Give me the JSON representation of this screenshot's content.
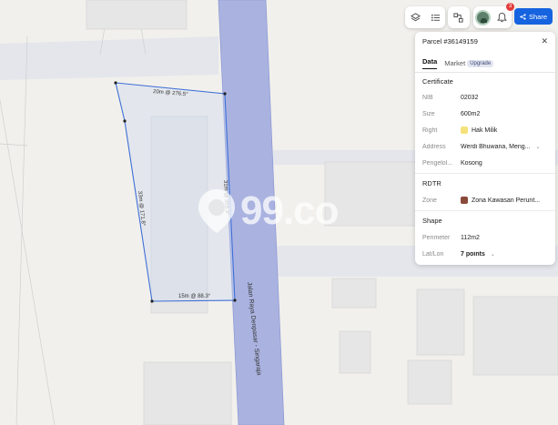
{
  "toolbar": {
    "layers_icon": "layers-icon",
    "list_icon": "list-icon",
    "select_icon": "select-area-icon",
    "notification_count": "3",
    "share_label": "Share"
  },
  "map": {
    "road_label": "Jalan Raya Denpasar - Singaraja",
    "edge_labels": {
      "top": "20m @ 276.5°",
      "left": "33m @ 171.8°",
      "right": "31m @ 359.3°",
      "bottom": "15m @ 88.3°"
    },
    "watermark": "99.co",
    "colors": {
      "road": "#aab3e0",
      "parcel_stroke": "#3f6fd6",
      "building": "#e6e6e6"
    }
  },
  "panel": {
    "title": "Parcel #36149159",
    "tabs": {
      "data": "Data",
      "market": "Market",
      "upgrade": "Upgrade"
    },
    "certificate": {
      "heading": "Certificate",
      "nib": {
        "label": "NIB",
        "value": "02032"
      },
      "size": {
        "label": "Size",
        "value": "600m2"
      },
      "right": {
        "label": "Right",
        "value": "Hak Milik",
        "color": "#f6e27c"
      },
      "address": {
        "label": "Address",
        "value": "Werdi Bhuwana, Meng..."
      },
      "pengelola": {
        "label": "Pengelol...",
        "value": "Kosong"
      }
    },
    "rdtr": {
      "heading": "RDTR",
      "zone": {
        "label": "Zone",
        "value": "Zona Kawasan Perunt...",
        "color": "#8a4a3a"
      }
    },
    "shape": {
      "heading": "Shape",
      "perimeter": {
        "label": "Perimeter",
        "value": "112m2"
      },
      "latlon": {
        "label": "Lat/Lon",
        "value": "7 points"
      }
    }
  }
}
